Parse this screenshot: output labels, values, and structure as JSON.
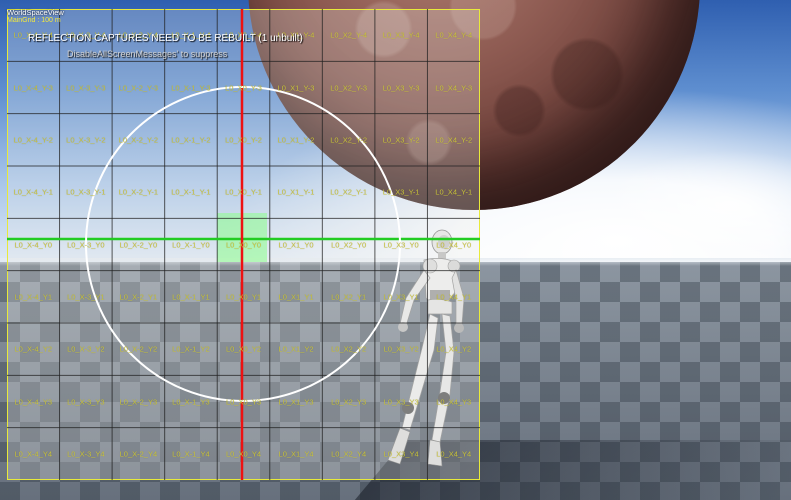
{
  "hud": {
    "title": "WorldSpaceView",
    "grid_size": "MainGrid : 100 m"
  },
  "messages": {
    "reflection_warning": "REFLECTION CAPTURES NEED TO BE REBUILT (1 unbuilt)",
    "suppress_hint": "DisableAllScreenMessages' to suppress"
  },
  "grid": {
    "columns": [
      "X-4",
      "X-3",
      "X-2",
      "X-1",
      "X0",
      "X1",
      "X2",
      "X3",
      "X4"
    ],
    "rows": [
      "Y-4",
      "Y-3",
      "Y-2",
      "Y-1",
      "Y0",
      "Y1",
      "Y2",
      "Y3",
      "Y4"
    ],
    "label_prefix": "L0",
    "highlighted_cell": "L0_X0_Y0",
    "colors": {
      "border": "#e8ea3a",
      "label": "#c9c33a",
      "x_axis": "#22cc22",
      "y_axis": "#ee1111",
      "highlight": "#8cff8c",
      "circle": "#ffffff"
    }
  },
  "scene": {
    "objects": [
      "sky",
      "sphere",
      "floor",
      "mannequin"
    ]
  }
}
